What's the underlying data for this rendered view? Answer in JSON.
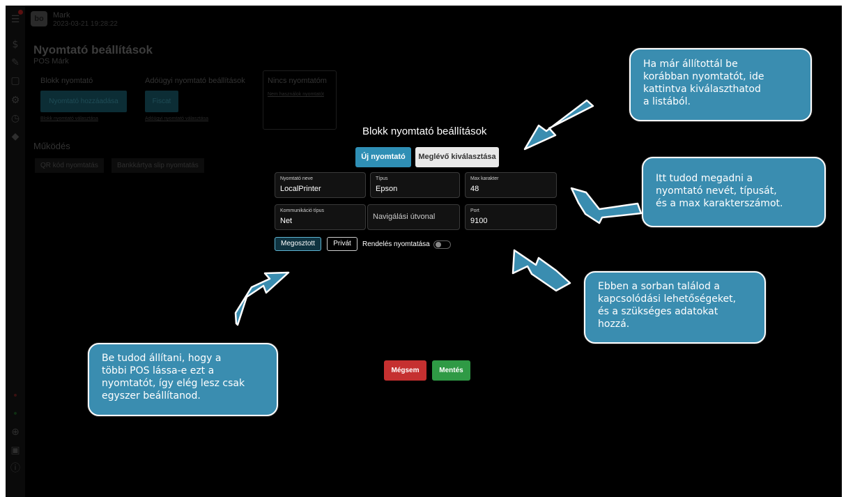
{
  "app": {
    "user_name": "Mark",
    "user_date": "2023-03-21 19:28:22",
    "logo_text": "bo"
  },
  "background": {
    "page_title": "Nyomtató beállítások",
    "page_subtitle": "POS Márk",
    "receipt_printer_label": "Blokk nyomtató",
    "add_printer_button": "Nyomtató hozzáadása",
    "choose_receipt_printer_link": "Blokk nyomtató választása",
    "tax_printer_label": "Adóügyi nyomtató beállítások",
    "fiscat_button": "Fiscat",
    "choose_tax_printer_link": "Adóügyi nyomtató választása",
    "no_printer_title": "Nincs nyomtatóm",
    "no_printer_link": "Nem használok nyomtatót",
    "operation_section": "Működés",
    "chips": [
      "QR kód nyomtatás",
      "Bankkártya slip nyomtatás"
    ]
  },
  "modal": {
    "title": "Blokk nyomtató beállítások",
    "tabs": [
      {
        "label": "Új nyomtató",
        "active": true
      },
      {
        "label": "Meglévő kiválasztása",
        "active": false
      }
    ],
    "fields": {
      "printer_name": {
        "label": "Nyomtató neve",
        "value": "LocalPrinter"
      },
      "type": {
        "label": "Típus",
        "value": "Epson"
      },
      "max_chars": {
        "label": "Max karakter",
        "value": "48"
      },
      "comm_type": {
        "label": "Kommunikáció típus",
        "value": "Net"
      },
      "nav_path": {
        "placeholder": "Navigálási útvonal"
      },
      "port": {
        "label": "Port",
        "value": "9100"
      }
    },
    "share_buttons": [
      {
        "label": "Megosztott",
        "active": true
      },
      {
        "label": "Privát",
        "active": false
      }
    ],
    "order_print_label": "Rendelés nyomtatása",
    "order_print_enabled": false,
    "cancel_button": "Mégsem",
    "save_button": "Mentés"
  },
  "callouts": {
    "top_right": [
      "Ha már állítottál be",
      "korábban nyomtatót, ide",
      "kattintva kiválaszthatod",
      "a listából."
    ],
    "middle_right": [
      "Itt tudod megadni a",
      "nyomtató nevét, típusát,",
      "és a max karakterszámot."
    ],
    "lower_right": [
      "Ebben a sorban találod a",
      "kapcsolódási lehetőségeket,",
      "és a szükséges adatokat",
      "hozzá."
    ],
    "lower_left": [
      "Be tudod állítani, hogy a",
      "többi POS lássa-e ezt a",
      "nyomtatót, így elég lesz csak",
      "egyszer beállítanod."
    ]
  },
  "colors": {
    "primary": "#2f8fb5",
    "danger": "#c53030",
    "success": "#2f9a45",
    "callout": "#3a8db0"
  }
}
